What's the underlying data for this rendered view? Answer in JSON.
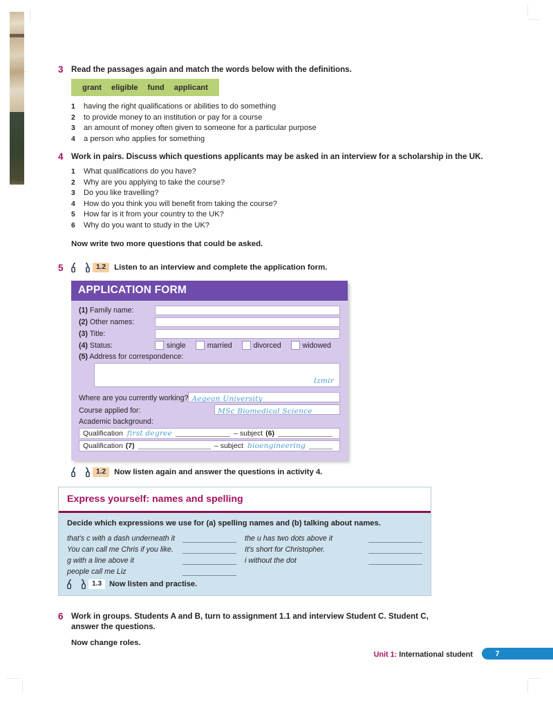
{
  "activity3": {
    "number": "3",
    "heading": "Read the passages again and match the words below with the definitions.",
    "words": [
      "grant",
      "eligible",
      "fund",
      "applicant"
    ],
    "definitions": [
      {
        "n": "1",
        "text": "having the right qualifications or abilities to do something"
      },
      {
        "n": "2",
        "text": "to provide money to an institution or pay for a course"
      },
      {
        "n": "3",
        "text": "an amount of money often given to someone for a particular purpose"
      },
      {
        "n": "4",
        "text": "a person who applies for something"
      }
    ]
  },
  "activity4": {
    "number": "4",
    "heading": "Work in pairs. Discuss which questions applicants may be asked in an interview for a scholarship in the UK.",
    "questions": [
      {
        "n": "1",
        "text": "What qualifications do you have?"
      },
      {
        "n": "2",
        "text": "Why are you applying to take the course?"
      },
      {
        "n": "3",
        "text": "Do you like travelling?"
      },
      {
        "n": "4",
        "text": "How do you think you will benefit from taking the course?"
      },
      {
        "n": "5",
        "text": "How far is it from your country to the UK?"
      },
      {
        "n": "6",
        "text": "Why do you want to study in the UK?"
      }
    ],
    "followup": "Now write two more questions that could be asked."
  },
  "activity5": {
    "number": "5",
    "track": "1.2",
    "heading": "Listen to an interview and complete the application form.",
    "form": {
      "title": "APPLICATION FORM",
      "fields": [
        {
          "num": "(1)",
          "label": "Family name:",
          "value": ""
        },
        {
          "num": "(2)",
          "label": "Other names:",
          "value": ""
        },
        {
          "num": "(3)",
          "label": "Title:",
          "value": ""
        }
      ],
      "status": {
        "num": "(4)",
        "label": "Status:",
        "options": [
          "single",
          "married",
          "divorced",
          "widowed"
        ]
      },
      "address": {
        "num": "(5)",
        "label": "Address for correspondence:",
        "value": "Izmir"
      },
      "working": {
        "label": "Where are you currently working?",
        "value": "Aegean University"
      },
      "course": {
        "label": "Course applied for:",
        "value": "MSc Biomedical Science"
      },
      "academic_label": "Academic background:",
      "qualifications": [
        {
          "qual_label": "Qualification",
          "qual_value": "first degree",
          "subject_label": "– subject",
          "subject_num": "(6)",
          "subject_value": ""
        },
        {
          "qual_label": "Qualification",
          "qual_num": "(7)",
          "qual_value": "",
          "subject_label": "– subject",
          "subject_value": "bioengineering"
        }
      ]
    },
    "after_track": "1.2",
    "after_text": "Now listen again and answer the questions in activity 4."
  },
  "express": {
    "title": "Express yourself: names and spelling",
    "intro": "Decide which expressions we use for (a) spelling names and (b) talking about names.",
    "left_items": [
      "that's c with a dash underneath it",
      "You can call me Chris if you like.",
      "g with a line above it",
      "people call me Liz"
    ],
    "right_items": [
      "the u has two dots above it",
      "It's short for Christopher.",
      "i without the dot"
    ],
    "track": "1.3",
    "audio_text": "Now listen and practise."
  },
  "activity6": {
    "number": "6",
    "heading": "Work in groups. Students A and B, turn to assignment 1.1 and interview Student C. Student C, answer the questions.",
    "followup": "Now change roles."
  },
  "footer": {
    "unit": "Unit 1:",
    "unit_title": "International student",
    "page": "7"
  },
  "colors": {
    "accent_magenta": "#a5115e",
    "form_header_purple": "#6f4bab",
    "form_body_lavender": "#d7c9ec",
    "word_bar_green": "#b8d176",
    "express_blue": "#cfe3ef",
    "page_tab_blue": "#1b87c9",
    "handwriting_blue": "#4b9bd6",
    "track_tag_peach": "#f6cfa4"
  }
}
